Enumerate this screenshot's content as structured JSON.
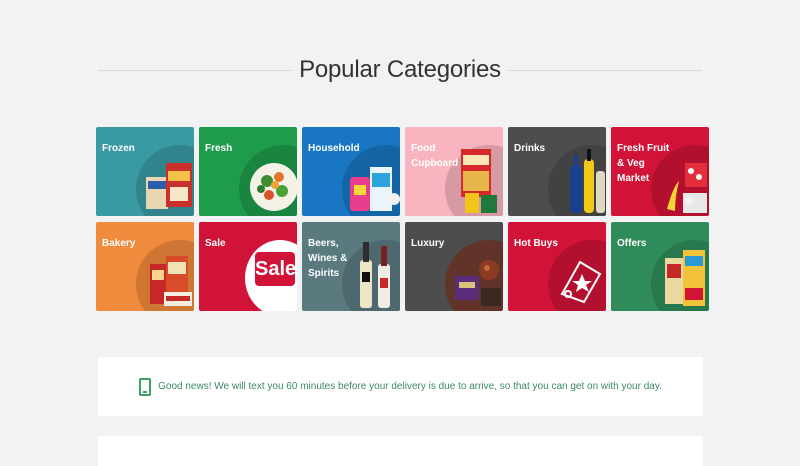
{
  "heading": "Popular Categories",
  "categories": [
    {
      "label": "Frozen",
      "color": "#3a9aa3",
      "icon": "frozen-food-image"
    },
    {
      "label": "Fresh",
      "color": "#1e9b4b",
      "icon": "salad-image"
    },
    {
      "label": "Household",
      "color": "#1976c2",
      "icon": "detergent-image"
    },
    {
      "label": "Food\nCupboard",
      "color": "#f8b4bf",
      "icon": "cereal-box-image"
    },
    {
      "label": "Drinks",
      "color": "#4d4d4d",
      "icon": "soft-drink-bottles-image"
    },
    {
      "label": "Fresh Fruit\n& Veg\nMarket",
      "color": "#d11338",
      "icon": "fruit-image"
    },
    {
      "label": "Bakery",
      "color": "#f08a3c",
      "icon": "bread-image"
    },
    {
      "label": "Sale",
      "color": "#d11338",
      "icon": "sale-tag-image"
    },
    {
      "label": "Beers,\nWines &\nSpirits",
      "color": "#5a7a80",
      "icon": "wine-bottles-image"
    },
    {
      "label": "Luxury",
      "color": "#4d4d4d",
      "icon": "luxury-food-image"
    },
    {
      "label": "Hot Buys",
      "color": "#d11338",
      "icon": "star-tag-icon"
    },
    {
      "label": "Offers",
      "color": "#2f8c5a",
      "icon": "offer-products-image"
    }
  ],
  "sale_badge": "Sale",
  "notice": {
    "text": "Good news! We will text you 60 minutes before your delivery is due to arrive, so that you can get on with your day.",
    "icon": "mobile-phone-icon",
    "accent": "#3aa06a"
  }
}
